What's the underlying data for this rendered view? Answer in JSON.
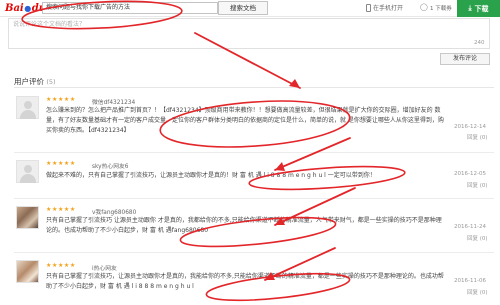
{
  "header": {
    "logo_bai": "Bai",
    "logo_du": "du",
    "logo_wenku": "文库",
    "search_value": "搜索问题与找你下载广告的方法",
    "search_button": "搜索文档",
    "mobile_link": "在手机打开",
    "download_count": "1 下载券",
    "download_button": "下载"
  },
  "comment": {
    "placeholder": "说说评论这个文档的看法？",
    "char_count": "240",
    "publish_button": "发布评论"
  },
  "reviews": {
    "title": "用户评价",
    "count": "(5)",
    "items": [
      {
        "stars": "★★★★★",
        "username": "微信df4321234",
        "text": "怎么赚米到的？怎么把产品推广到首页？！【df4321234】顶级商用带来教你！！想要做高流量较差，但很结果就是扩大你的交际圈，增加好友的 数量，有了好友数量基础才有一定的客户成交量。定位你的客户群体分类明白的依据商的定位是什么，简单的说，就 是你想要让哪些人从你这里得到，购买你卖的东西。【df4321234】",
        "date": "2016-12-14",
        "reply": "回复 (0)"
      },
      {
        "stars": "★★★★★",
        "username": "sky热心网友6",
        "text": "做起来不难的，只有自己掌握了引流技巧，让源员主动跟你才是真的！财 富 机 遇 l i 8 8 8 m e n g h u l 一定可以带到你！",
        "date": "2016-12-05",
        "reply": "回复 (0)"
      },
      {
        "stars": "★★★★★",
        "username": "v我fang680680",
        "text": "只有自己掌握了引流技巧 让源员主动跟你 才是真的，我都给你的不多,只能给你渠道不断的精准流量，人气带来财气，都是一些实操的技巧不是那种理论的。也成功帮助了不少小白起步，财 富 机 遇fang680680",
        "date": "2016-11-24",
        "reply": "回复 (0)"
      },
      {
        "stars": "★★★★★",
        "username": "i热心网友",
        "text": "只有自己掌握了引流技巧，让源员主动跟你才是真的，我能给你的不多,只能给你渠道不断的精准流量，都是一些实操的技巧不是那种理论的。也成功帮助了不少小白起步，财 富 机 遇 l i 8 8 8 m e n g h u l",
        "date": "2016-11-06",
        "reply": "回复 (0)"
      }
    ]
  },
  "colors": {
    "accent_green": "#2aa14b",
    "annotation_red": "#e3262a",
    "star_orange": "#f3a21b"
  }
}
